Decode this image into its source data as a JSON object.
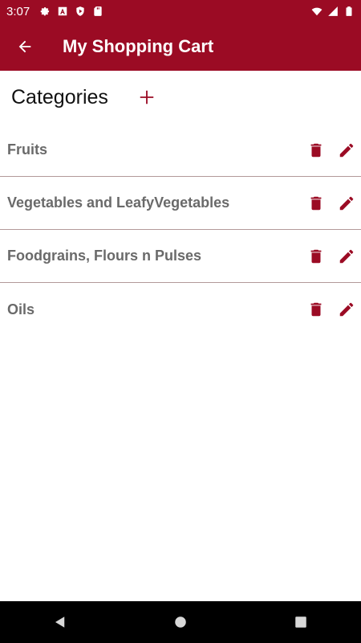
{
  "status_bar": {
    "time": "3:07",
    "left_icons": [
      "settings-icon",
      "a-letter-icon",
      "shield-play-icon",
      "sd-card-icon"
    ],
    "right_icons": [
      "wifi-icon",
      "signal-icon",
      "battery-icon"
    ]
  },
  "app_bar": {
    "title": "My Shopping Cart",
    "back_icon": "arrow-back-icon",
    "color": "#9b0b24"
  },
  "categories": {
    "title": "Categories",
    "add_icon": "plus-icon",
    "items": [
      {
        "label": "Fruits"
      },
      {
        "label": "Vegetables and LeafyVegetables"
      },
      {
        "label": "Foodgrains, Flours n Pulses"
      },
      {
        "label": "Oils"
      }
    ]
  },
  "nav_bar": {
    "icons": [
      "back-triangle-icon",
      "home-circle-icon",
      "recents-square-icon"
    ]
  }
}
